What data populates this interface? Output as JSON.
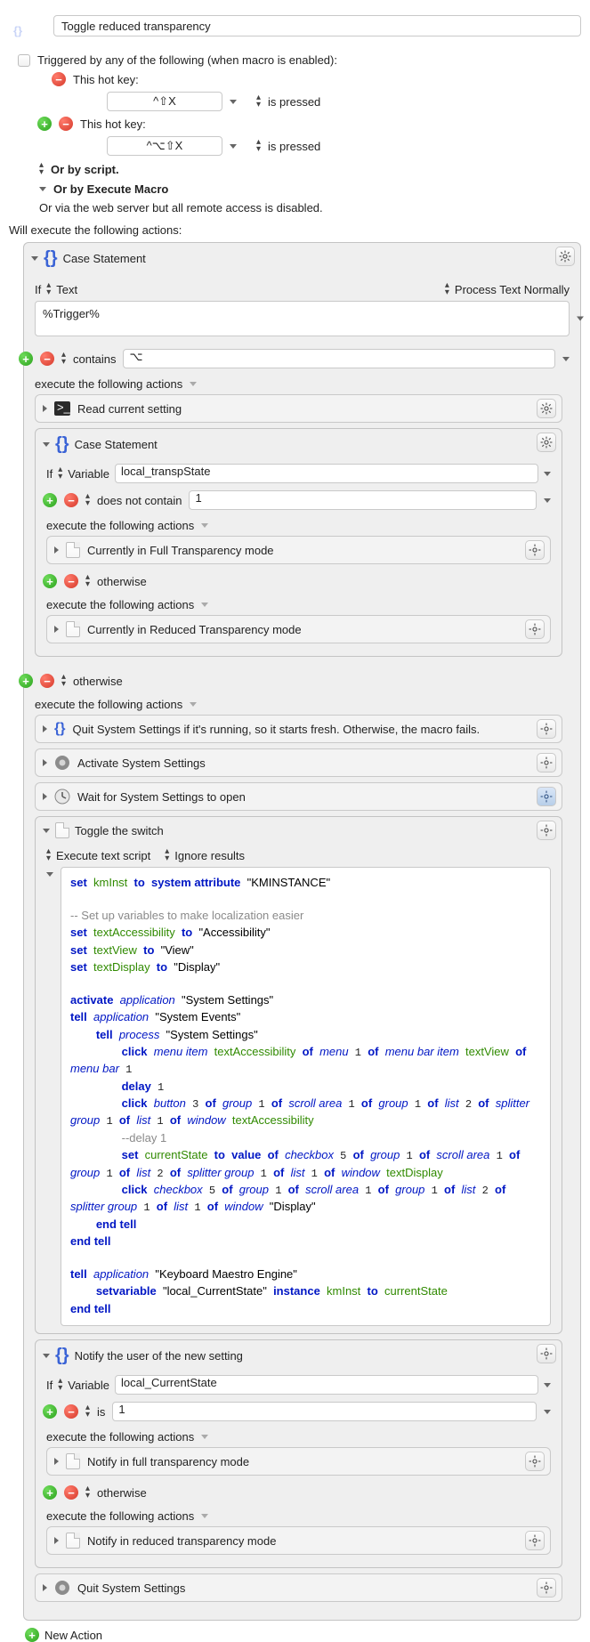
{
  "macro": {
    "title": "Toggle reduced transparency",
    "trigger_header": "Triggered by any of the following (when macro is enabled):"
  },
  "triggers": {
    "hotkey1": {
      "label": "This hot key:",
      "key": "^⇧X",
      "mode": "is pressed"
    },
    "hotkey2": {
      "label": "This hot key:",
      "key": "^⌥⇧X",
      "mode": "is pressed"
    },
    "script_line": "Or by script.",
    "exec_macro_line": "Or by Execute Macro",
    "webserver_line": "Or via the web server but all remote access is disabled."
  },
  "exec_header": "Will execute the following actions:",
  "case1": {
    "title": "Case Statement",
    "if_label": "If",
    "type": "Text",
    "proc_label": "Process Text Normally",
    "text_value": "%Trigger%",
    "branch1": {
      "op": "contains",
      "value": "⌥",
      "exec_label": "execute the following actions",
      "a1": "Read current setting",
      "inner_case": {
        "title": "Case Statement",
        "if_label": "If",
        "type": "Variable",
        "var": "local_transpState",
        "b1": {
          "op": "does not contain",
          "value": "1",
          "exec_label": "execute the following actions",
          "a": "Currently in Full Transparency mode"
        },
        "b2": {
          "op": "otherwise",
          "exec_label": "execute the following actions",
          "a": "Currently in Reduced Transparency mode"
        }
      }
    },
    "branch2": {
      "op": "otherwise",
      "exec_label": "execute the following actions",
      "a1": "Quit System Settings if it's running, so it starts fresh. Otherwise, the macro fails.",
      "a2": "Activate System Settings",
      "a3": "Wait for System Settings to open",
      "toggle": {
        "title": "Toggle the switch",
        "exec_label": "Execute text script",
        "ignore_label": "Ignore results"
      }
    }
  },
  "notify_case": {
    "title": "Notify the user of the new setting",
    "if_label": "If",
    "type": "Variable",
    "var": "local_CurrentState",
    "b1": {
      "op": "is",
      "value": "1",
      "exec_label": "execute the following actions",
      "a": "Notify in full transparency mode"
    },
    "b2": {
      "op": "otherwise",
      "exec_label": "execute the following actions",
      "a": "Notify in reduced transparency mode"
    }
  },
  "quit_action": "Quit System Settings",
  "new_action": "New Action",
  "chart_data": null
}
